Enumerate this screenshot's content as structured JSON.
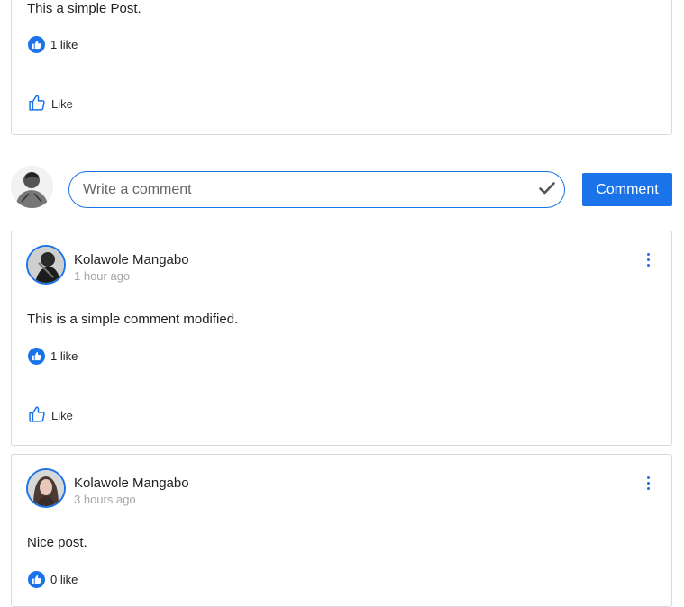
{
  "post": {
    "text": "This a simple Post.",
    "likes_text": "1 like",
    "like_label": "Like"
  },
  "composer": {
    "placeholder": "Write a comment",
    "submit_label": "Comment"
  },
  "comments": [
    {
      "author": "Kolawole Mangabo",
      "time": "1 hour ago",
      "text": "This is a simple comment modified.",
      "likes_text": "1 like",
      "like_label": "Like"
    },
    {
      "author": "Kolawole Mangabo",
      "time": "3 hours ago",
      "text": "Nice post.",
      "likes_text": "0 like"
    }
  ],
  "colors": {
    "accent": "#1a73e8",
    "border": "#d9d9d9",
    "muted": "#a6a6a6"
  },
  "icons": {
    "likes_badge": "thumbs-up-filled-icon",
    "like_button": "thumbs-up-outline-icon",
    "submit_check": "checkmark-icon",
    "menu": "more-vertical-icon"
  }
}
